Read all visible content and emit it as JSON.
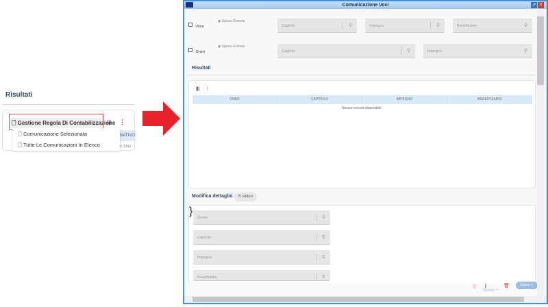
{
  "left_panel": {
    "title": "Risultati",
    "button_label": "Gestione Regola Di Contabilizzazione",
    "menu_items": [
      "Comunicazione Selezionata",
      "Tutte Le Comunicazioni In Elenco"
    ],
    "header_fragment": "NATIVO",
    "cell_fragment": "E OID"
  },
  "window": {
    "title": "Comunicazione Voci",
    "row1": {
      "checkbox_label": "Voce",
      "radio_spesa": "Spesa",
      "radio_entrata": "Entrata",
      "fields": [
        "Capitolo",
        "Impegno",
        "Beneficiario"
      ]
    },
    "row2": {
      "checkbox_label": "Oneri",
      "radio_spesa": "Spesa",
      "radio_entrata": "Entrata",
      "fields": [
        "Capitolo",
        "Impegno"
      ]
    },
    "results": {
      "title": "Risultati",
      "columns": [
        "ONER",
        "CAPITOLO",
        "IMPEGNO",
        "BENEFICIARIO"
      ],
      "empty": "Nessun record disponibile."
    },
    "detail": {
      "title": "Modifica dettaglio",
      "collapse_label": "Riduci",
      "fields": [
        "Onere",
        "Capitolo",
        "Impegno",
        "Beneficiario"
      ]
    },
    "footer": {
      "save_label": "Salva",
      "new_label": "Nuovo"
    }
  },
  "colors": {
    "accent": "#3a8ee6",
    "danger": "#e0464f",
    "header_bg": "#dbeaf8"
  }
}
